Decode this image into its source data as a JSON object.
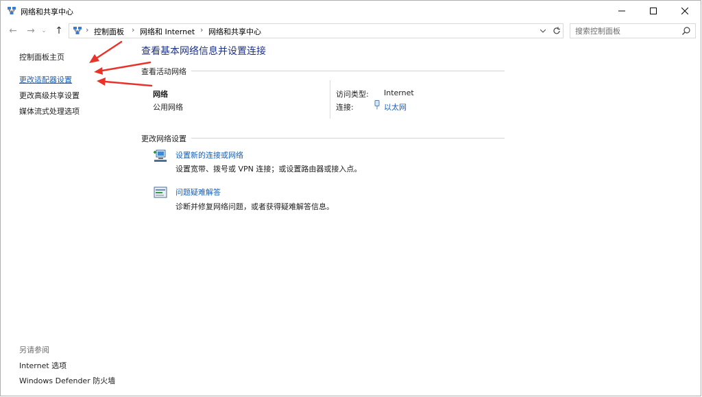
{
  "window": {
    "title": "网络和共享中心"
  },
  "address": {
    "breadcrumbs": [
      "控制面板",
      "网络和 Internet",
      "网络和共享中心"
    ],
    "search_placeholder": "搜索控制面板"
  },
  "left_pane": {
    "links": [
      "控制面板主页",
      "更改适配器设置",
      "更改高级共享设置",
      "媒体流式处理选项"
    ],
    "see_also_title": "另请参阅",
    "see_also_links": [
      "Internet 选项",
      "Windows Defender 防火墙"
    ]
  },
  "main": {
    "title": "查看基本网络信息并设置连接",
    "active_networks_head": "查看活动网络",
    "network": {
      "name": "网络",
      "type": "公用网络",
      "access_label": "访问类型:",
      "access_value": "Internet",
      "connection_label": "连接:",
      "connection_value": "以太网"
    },
    "change_settings_head": "更改网络设置",
    "tasks": [
      {
        "title": "设置新的连接或网络",
        "desc": "设置宽带、拨号或 VPN 连接；或设置路由器或接入点。"
      },
      {
        "title": "问题疑难解答",
        "desc": "诊断并修复网络问题，或者获得疑难解答信息。"
      }
    ]
  },
  "colors": {
    "link": "#1a5fb4",
    "title": "#1e3287",
    "annotation_arrow": "#e8332a"
  }
}
